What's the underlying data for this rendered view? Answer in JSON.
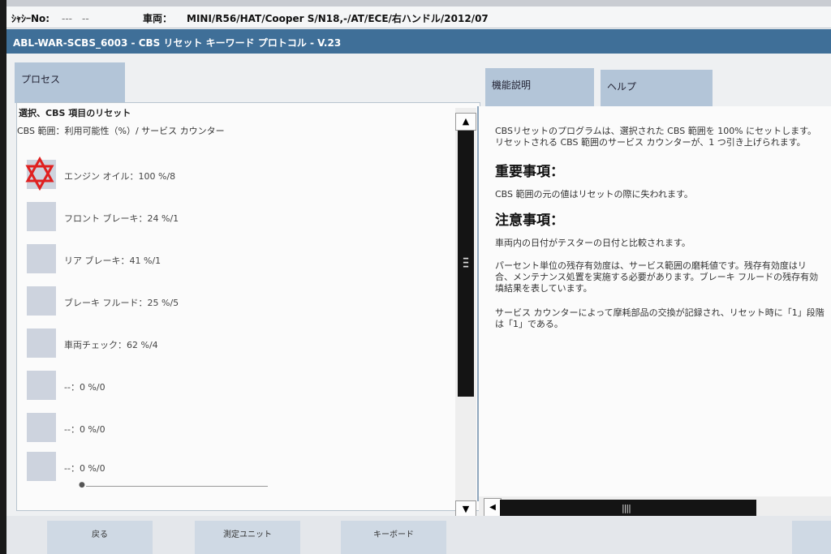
{
  "vehicle_bar": {
    "chassis_label": "ｼｬｼｰNo:",
    "chassis_value": "‐‐‐　‐‐",
    "vehicle_label": "車両：",
    "vehicle_value": "MINI/R56/HAT/Cooper S/N18,-/AT/ECE/右ハンドル/2012/07"
  },
  "title_bar": {
    "title": "ABL-WAR-SCBS_6003 - CBS リセット キーワード プロトコル - V.23"
  },
  "tabs": {
    "process": "プロセス",
    "function_desc": "機能説明",
    "help": "ヘルプ"
  },
  "left_panel": {
    "title": "選択、CBS 項目のリセット",
    "subtitle": "CBS 範囲：利用可能性（%）/ サービス カウンター",
    "items": [
      {
        "label": "エンジン オイル：100 %/8",
        "selected": true
      },
      {
        "label": "フロント ブレーキ：24 %/1"
      },
      {
        "label": "リア ブレーキ：41 %/1"
      },
      {
        "label": "ブレーキ フルード：25 %/5"
      },
      {
        "label": "車両チェック：62 %/4"
      },
      {
        "label": "--：0 %/0"
      },
      {
        "label": "--：0 %/0"
      },
      {
        "label": "--：0 %/0"
      }
    ]
  },
  "right_panel": {
    "intro_line1": "CBSリセットのプログラムは、選択された CBS 範囲を 100% にセットします。",
    "intro_line2": "リセットされる CBS 範囲のサービス カウンターが、1 つ引き上げられます。",
    "important_heading": "重要事項：",
    "important_text": "CBS 範囲の元の値はリセットの際に失われます。",
    "caution_heading": "注意事項：",
    "caution_text": "車両内の日付がテスターの日付と比較されます。",
    "para_line1": "パーセント単位の残存有効度は、サービス範囲の磨耗値です。残存有効度はリ",
    "para_line2": "合、メンテナンス処置を実施する必要があります。ブレーキ フルードの残存有効",
    "para_line3": "填結果を表しています。",
    "counter_line1": "サービス カウンターによって摩耗部品の交換が記録され、リセット時に「1」段階",
    "counter_line2": "は「1」である。"
  },
  "footer": {
    "back": "戻る",
    "measure_unit": "測定ユニット",
    "keyboard": "キーボード"
  },
  "icons": {
    "selected_marker": "star-of-david-icon",
    "scroll_up": "triangle-up-icon",
    "scroll_down": "triangle-down-icon",
    "scroll_left": "triangle-left-icon",
    "scroll_grip": "grip-lines-icon"
  },
  "colors": {
    "title_bar": "#3f6f98",
    "tab": "#b3c5d8",
    "item_box": "#cdd3de",
    "selected_marker": "#e02020",
    "scrollbar": "#141414"
  }
}
